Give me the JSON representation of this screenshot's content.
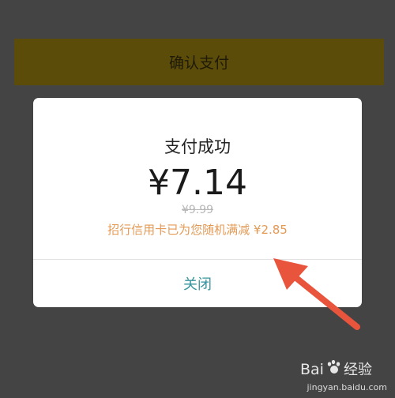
{
  "background": {
    "confirm_label": "确认支付"
  },
  "dialog": {
    "title": "支付成功",
    "amount": "¥7.14",
    "original_price": "¥9.99",
    "discount_text": "招行信用卡已为您随机满减 ¥2.85",
    "close_label": "关闭"
  },
  "watermark": {
    "brand": "Bai经验",
    "url": "jingyan.baidu.com"
  },
  "colors": {
    "amount_text": "#1a1a1a",
    "discount_text": "#e39a55",
    "close_text": "#36959d",
    "arrow": "#e8553c"
  },
  "icons": {
    "annotation": "red-arrow-icon",
    "watermark_logo": "baidu-paw-logo"
  }
}
